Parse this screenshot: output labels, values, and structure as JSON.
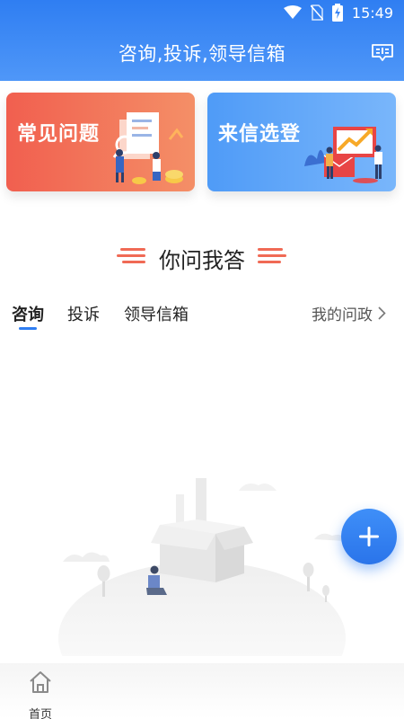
{
  "status_bar": {
    "time": "15:49",
    "icons": [
      "wifi-icon",
      "no-sim-icon",
      "battery-charging-icon"
    ]
  },
  "header": {
    "title": "咨询,投诉,领导信箱",
    "action_icon": "message-icon"
  },
  "cards": [
    {
      "title": "常见问题",
      "color_from": "#f15f4f",
      "color_to": "#f48f67"
    },
    {
      "title": "来信选登",
      "color_from": "#4f9bf7",
      "color_to": "#79b6fb"
    }
  ],
  "section": {
    "title": "你问我答"
  },
  "tabs": {
    "items": [
      "咨询",
      "投诉",
      "领导信箱"
    ],
    "active": "咨询",
    "link": "我的问政"
  },
  "fab": {
    "icon": "plus-icon"
  },
  "bottom_nav": {
    "items": [
      {
        "label": "首页",
        "icon": "home-icon"
      }
    ]
  },
  "colors": {
    "primary": "#2f7ef2",
    "accent_red": "#f15f4f"
  }
}
